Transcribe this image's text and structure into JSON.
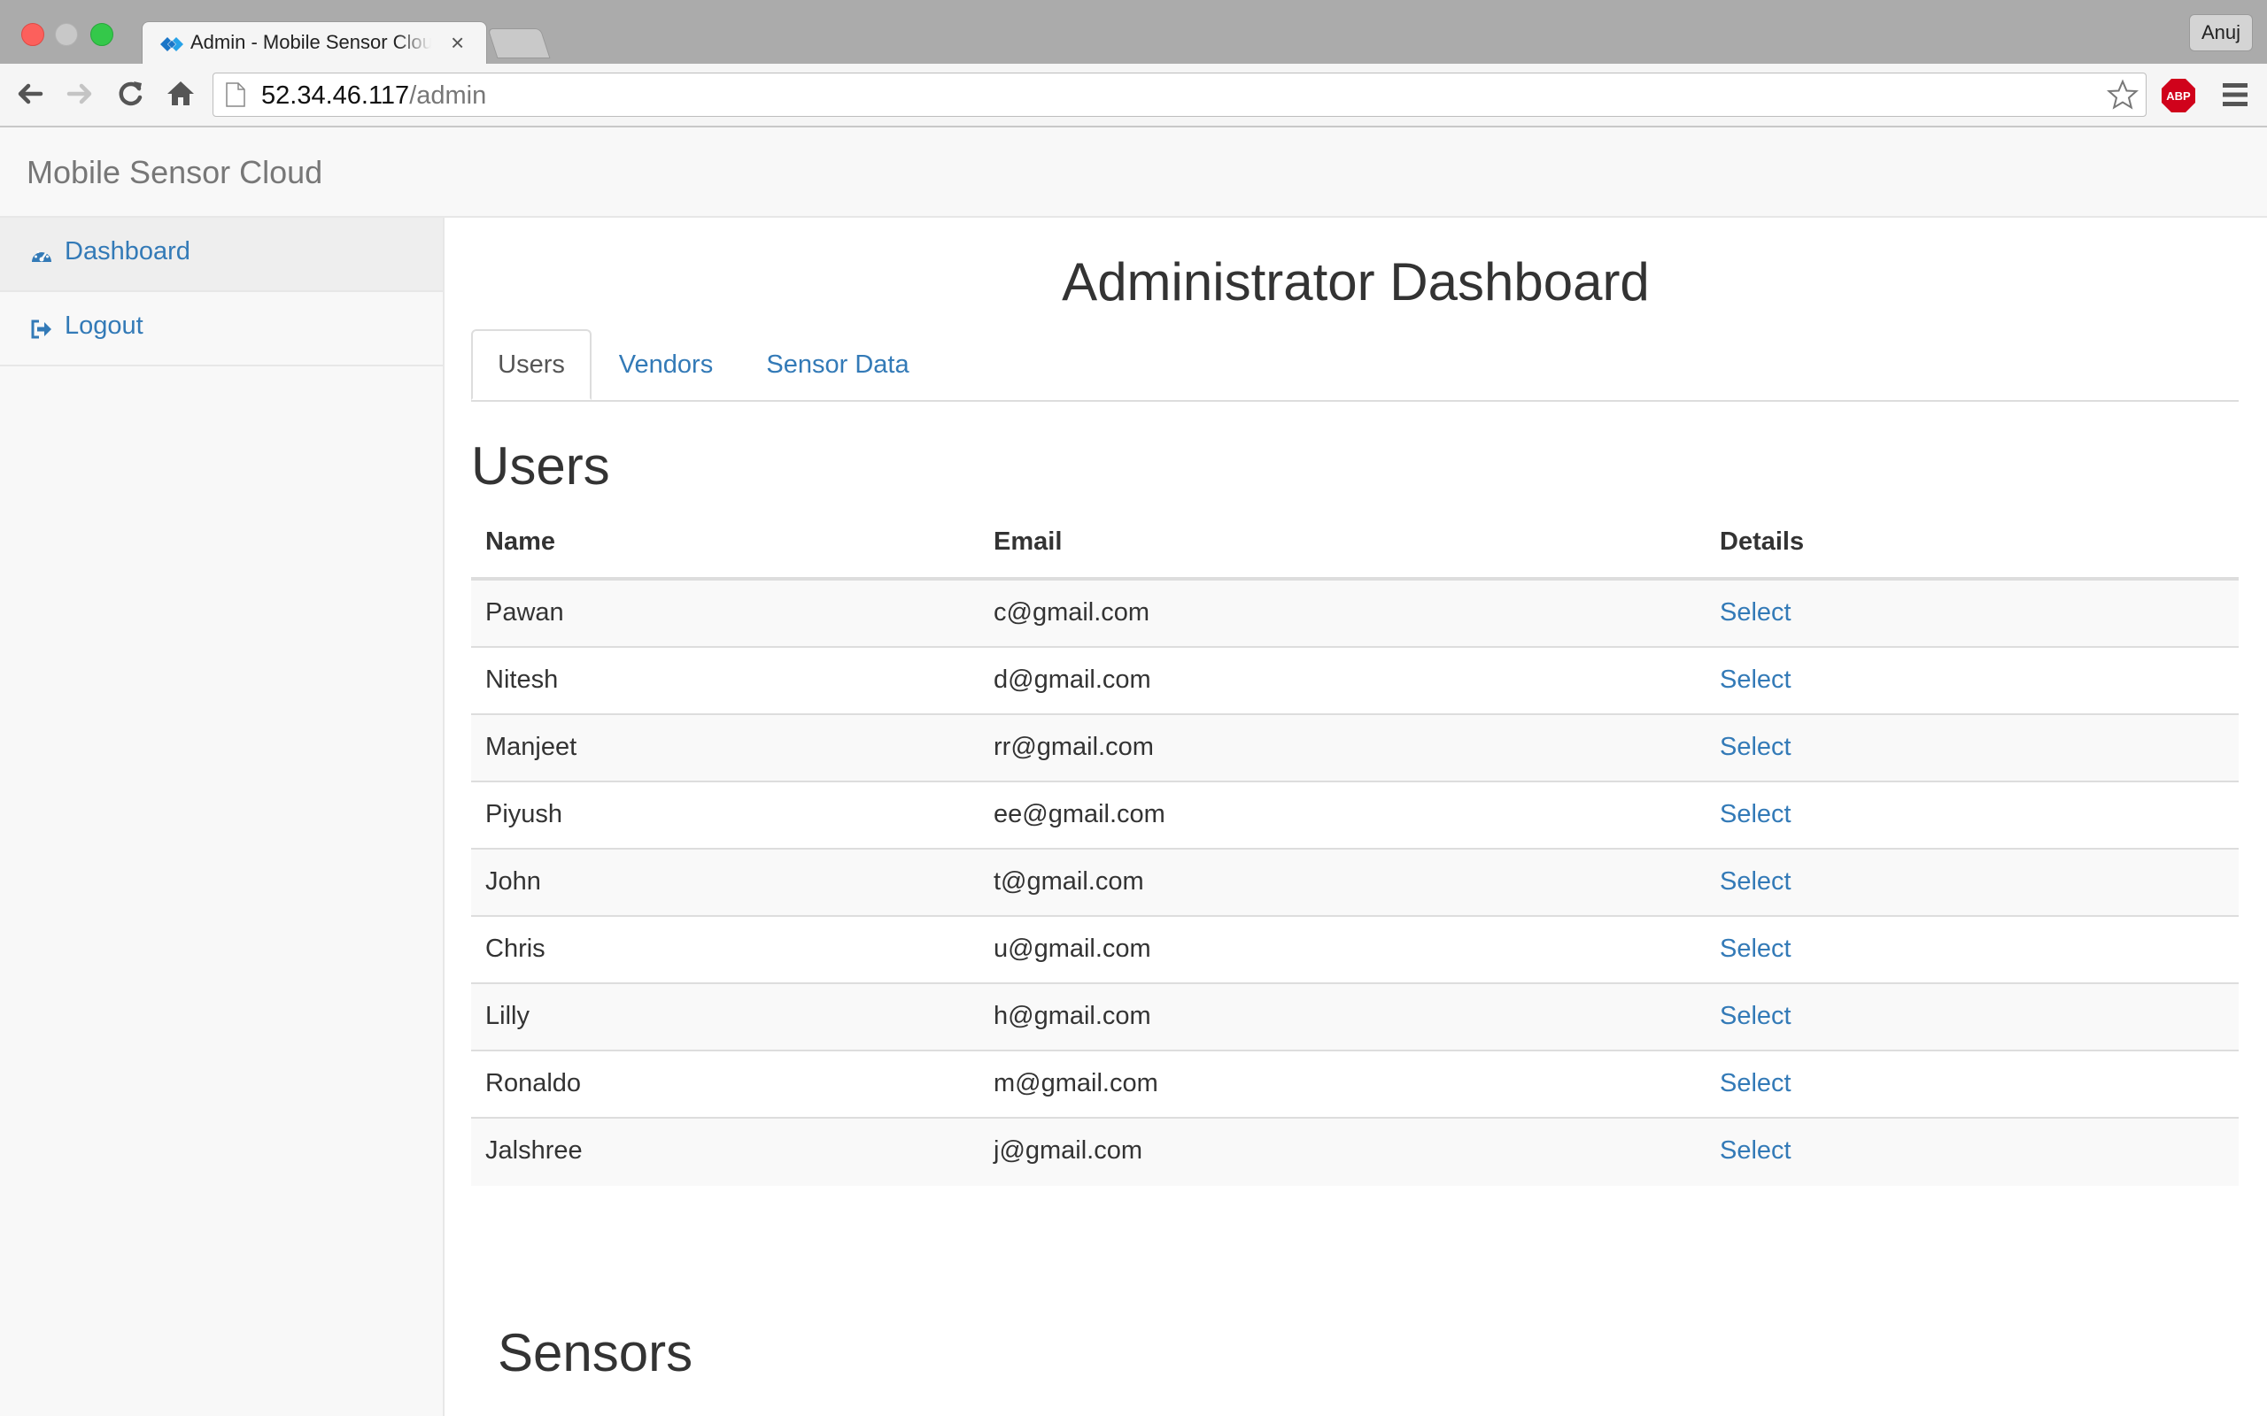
{
  "browser": {
    "tab_title": "Admin - Mobile Sensor Cloud",
    "tab_close": "×",
    "profile_name": "Anuj",
    "url_host": "52.34.46.117",
    "url_path": "/admin",
    "abp_label": "ABP",
    "icons": [
      "back-arrow-icon",
      "forward-arrow-icon",
      "reload-icon",
      "home-icon",
      "page-icon",
      "star-icon",
      "adblock-icon",
      "menu-icon"
    ]
  },
  "navbar": {
    "brand": "Mobile Sensor Cloud"
  },
  "sidebar": {
    "items": [
      {
        "label": "Dashboard",
        "icon": "dashboard-icon",
        "active": true
      },
      {
        "label": "Logout",
        "icon": "logout-icon",
        "active": false
      }
    ]
  },
  "main": {
    "title": "Administrator Dashboard",
    "tabs": [
      {
        "label": "Users",
        "active": true
      },
      {
        "label": "Vendors",
        "active": false
      },
      {
        "label": "Sensor Data",
        "active": false
      }
    ],
    "users_heading": "Users",
    "table": {
      "headers": [
        "Name",
        "Email",
        "Details"
      ],
      "rows": [
        {
          "name": "Pawan",
          "email": "c@gmail.com",
          "details": "Select"
        },
        {
          "name": "Nitesh",
          "email": "d@gmail.com",
          "details": "Select"
        },
        {
          "name": "Manjeet",
          "email": "rr@gmail.com",
          "details": "Select"
        },
        {
          "name": "Piyush",
          "email": "ee@gmail.com",
          "details": "Select"
        },
        {
          "name": "John",
          "email": "t@gmail.com",
          "details": "Select"
        },
        {
          "name": "Chris",
          "email": "u@gmail.com",
          "details": "Select"
        },
        {
          "name": "Lilly",
          "email": "h@gmail.com",
          "details": "Select"
        },
        {
          "name": "Ronaldo",
          "email": "m@gmail.com",
          "details": "Select"
        },
        {
          "name": "Jalshree",
          "email": "j@gmail.com",
          "details": "Select"
        }
      ]
    },
    "sensors_heading": "Sensors"
  },
  "colors": {
    "link": "#337ab7",
    "text": "#333333",
    "muted": "#777777",
    "sidebar_bg": "#f8f8f8",
    "abp_red": "#d0021b"
  }
}
